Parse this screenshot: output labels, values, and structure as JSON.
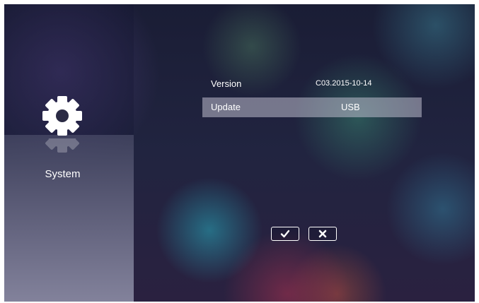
{
  "sidebar": {
    "label": "System",
    "icon": "gear-icon"
  },
  "rows": [
    {
      "label": "Version",
      "value": "C03.2015-10-14"
    },
    {
      "label": "Update",
      "value": "USB"
    }
  ],
  "buttons": {
    "confirm_icon": "check-icon",
    "cancel_icon": "close-icon"
  },
  "colors": {
    "text": "#ffffff",
    "highlight_row": "#b4b4c4"
  }
}
